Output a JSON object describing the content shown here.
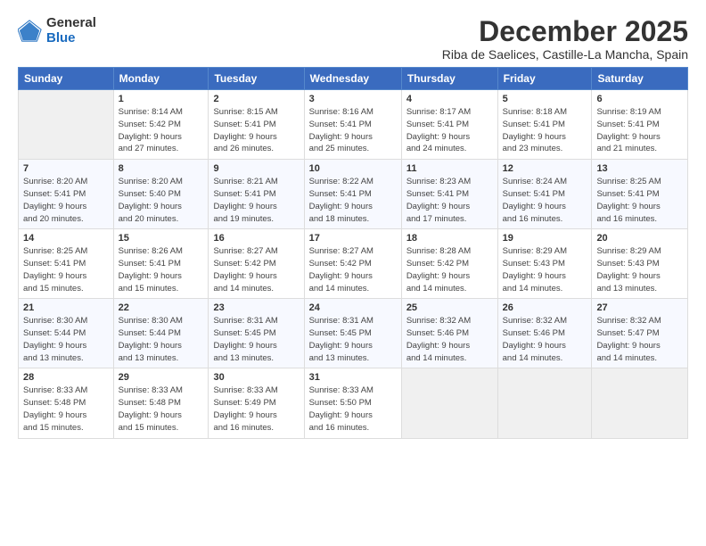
{
  "logo": {
    "general": "General",
    "blue": "Blue"
  },
  "header": {
    "month": "December 2025",
    "location": "Riba de Saelices, Castille-La Mancha, Spain"
  },
  "weekdays": [
    "Sunday",
    "Monday",
    "Tuesday",
    "Wednesday",
    "Thursday",
    "Friday",
    "Saturday"
  ],
  "weeks": [
    [
      {
        "day": "",
        "info": ""
      },
      {
        "day": "1",
        "info": "Sunrise: 8:14 AM\nSunset: 5:42 PM\nDaylight: 9 hours\nand 27 minutes."
      },
      {
        "day": "2",
        "info": "Sunrise: 8:15 AM\nSunset: 5:41 PM\nDaylight: 9 hours\nand 26 minutes."
      },
      {
        "day": "3",
        "info": "Sunrise: 8:16 AM\nSunset: 5:41 PM\nDaylight: 9 hours\nand 25 minutes."
      },
      {
        "day": "4",
        "info": "Sunrise: 8:17 AM\nSunset: 5:41 PM\nDaylight: 9 hours\nand 24 minutes."
      },
      {
        "day": "5",
        "info": "Sunrise: 8:18 AM\nSunset: 5:41 PM\nDaylight: 9 hours\nand 23 minutes."
      },
      {
        "day": "6",
        "info": "Sunrise: 8:19 AM\nSunset: 5:41 PM\nDaylight: 9 hours\nand 21 minutes."
      }
    ],
    [
      {
        "day": "7",
        "info": "Sunrise: 8:20 AM\nSunset: 5:41 PM\nDaylight: 9 hours\nand 20 minutes."
      },
      {
        "day": "8",
        "info": "Sunrise: 8:20 AM\nSunset: 5:40 PM\nDaylight: 9 hours\nand 20 minutes."
      },
      {
        "day": "9",
        "info": "Sunrise: 8:21 AM\nSunset: 5:41 PM\nDaylight: 9 hours\nand 19 minutes."
      },
      {
        "day": "10",
        "info": "Sunrise: 8:22 AM\nSunset: 5:41 PM\nDaylight: 9 hours\nand 18 minutes."
      },
      {
        "day": "11",
        "info": "Sunrise: 8:23 AM\nSunset: 5:41 PM\nDaylight: 9 hours\nand 17 minutes."
      },
      {
        "day": "12",
        "info": "Sunrise: 8:24 AM\nSunset: 5:41 PM\nDaylight: 9 hours\nand 16 minutes."
      },
      {
        "day": "13",
        "info": "Sunrise: 8:25 AM\nSunset: 5:41 PM\nDaylight: 9 hours\nand 16 minutes."
      }
    ],
    [
      {
        "day": "14",
        "info": "Sunrise: 8:25 AM\nSunset: 5:41 PM\nDaylight: 9 hours\nand 15 minutes."
      },
      {
        "day": "15",
        "info": "Sunrise: 8:26 AM\nSunset: 5:41 PM\nDaylight: 9 hours\nand 15 minutes."
      },
      {
        "day": "16",
        "info": "Sunrise: 8:27 AM\nSunset: 5:42 PM\nDaylight: 9 hours\nand 14 minutes."
      },
      {
        "day": "17",
        "info": "Sunrise: 8:27 AM\nSunset: 5:42 PM\nDaylight: 9 hours\nand 14 minutes."
      },
      {
        "day": "18",
        "info": "Sunrise: 8:28 AM\nSunset: 5:42 PM\nDaylight: 9 hours\nand 14 minutes."
      },
      {
        "day": "19",
        "info": "Sunrise: 8:29 AM\nSunset: 5:43 PM\nDaylight: 9 hours\nand 14 minutes."
      },
      {
        "day": "20",
        "info": "Sunrise: 8:29 AM\nSunset: 5:43 PM\nDaylight: 9 hours\nand 13 minutes."
      }
    ],
    [
      {
        "day": "21",
        "info": "Sunrise: 8:30 AM\nSunset: 5:44 PM\nDaylight: 9 hours\nand 13 minutes."
      },
      {
        "day": "22",
        "info": "Sunrise: 8:30 AM\nSunset: 5:44 PM\nDaylight: 9 hours\nand 13 minutes."
      },
      {
        "day": "23",
        "info": "Sunrise: 8:31 AM\nSunset: 5:45 PM\nDaylight: 9 hours\nand 13 minutes."
      },
      {
        "day": "24",
        "info": "Sunrise: 8:31 AM\nSunset: 5:45 PM\nDaylight: 9 hours\nand 13 minutes."
      },
      {
        "day": "25",
        "info": "Sunrise: 8:32 AM\nSunset: 5:46 PM\nDaylight: 9 hours\nand 14 minutes."
      },
      {
        "day": "26",
        "info": "Sunrise: 8:32 AM\nSunset: 5:46 PM\nDaylight: 9 hours\nand 14 minutes."
      },
      {
        "day": "27",
        "info": "Sunrise: 8:32 AM\nSunset: 5:47 PM\nDaylight: 9 hours\nand 14 minutes."
      }
    ],
    [
      {
        "day": "28",
        "info": "Sunrise: 8:33 AM\nSunset: 5:48 PM\nDaylight: 9 hours\nand 15 minutes."
      },
      {
        "day": "29",
        "info": "Sunrise: 8:33 AM\nSunset: 5:48 PM\nDaylight: 9 hours\nand 15 minutes."
      },
      {
        "day": "30",
        "info": "Sunrise: 8:33 AM\nSunset: 5:49 PM\nDaylight: 9 hours\nand 16 minutes."
      },
      {
        "day": "31",
        "info": "Sunrise: 8:33 AM\nSunset: 5:50 PM\nDaylight: 9 hours\nand 16 minutes."
      },
      {
        "day": "",
        "info": ""
      },
      {
        "day": "",
        "info": ""
      },
      {
        "day": "",
        "info": ""
      }
    ]
  ]
}
